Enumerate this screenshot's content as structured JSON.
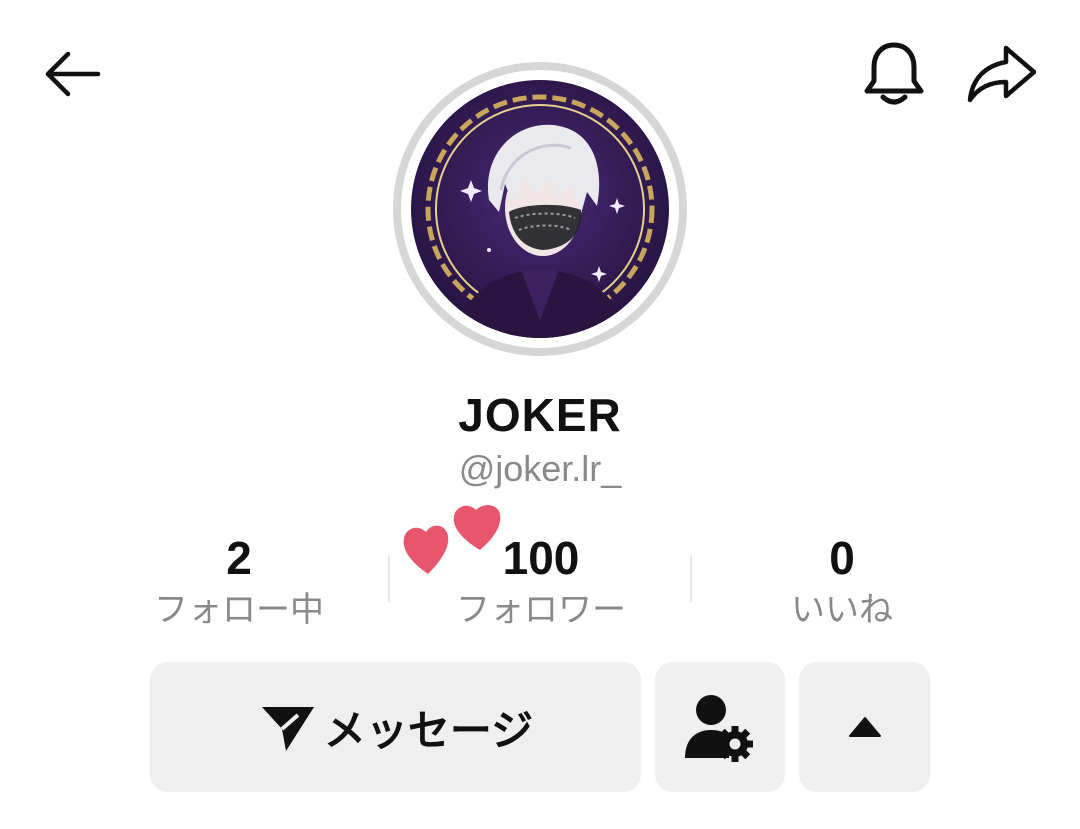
{
  "profile": {
    "display_name": "JOKER",
    "username": "@joker.lr_"
  },
  "stats": [
    {
      "value": "2",
      "label": "フォロー中"
    },
    {
      "value": "100",
      "label": "フォロワー"
    },
    {
      "value": "0",
      "label": "いいね"
    }
  ],
  "actions": {
    "message_label": "メッセージ"
  },
  "colors": {
    "heart": "#e8566d",
    "avatar_bg": "#3b1f5e",
    "frame_gold": "#c9a65b",
    "button_bg": "#efefef"
  },
  "icons": {
    "back": "arrow-left-icon",
    "notifications": "bell-icon",
    "share": "share-arrow-icon",
    "message": "send-icon",
    "user_settings": "user-gear-icon",
    "expand": "caret-up-icon"
  }
}
